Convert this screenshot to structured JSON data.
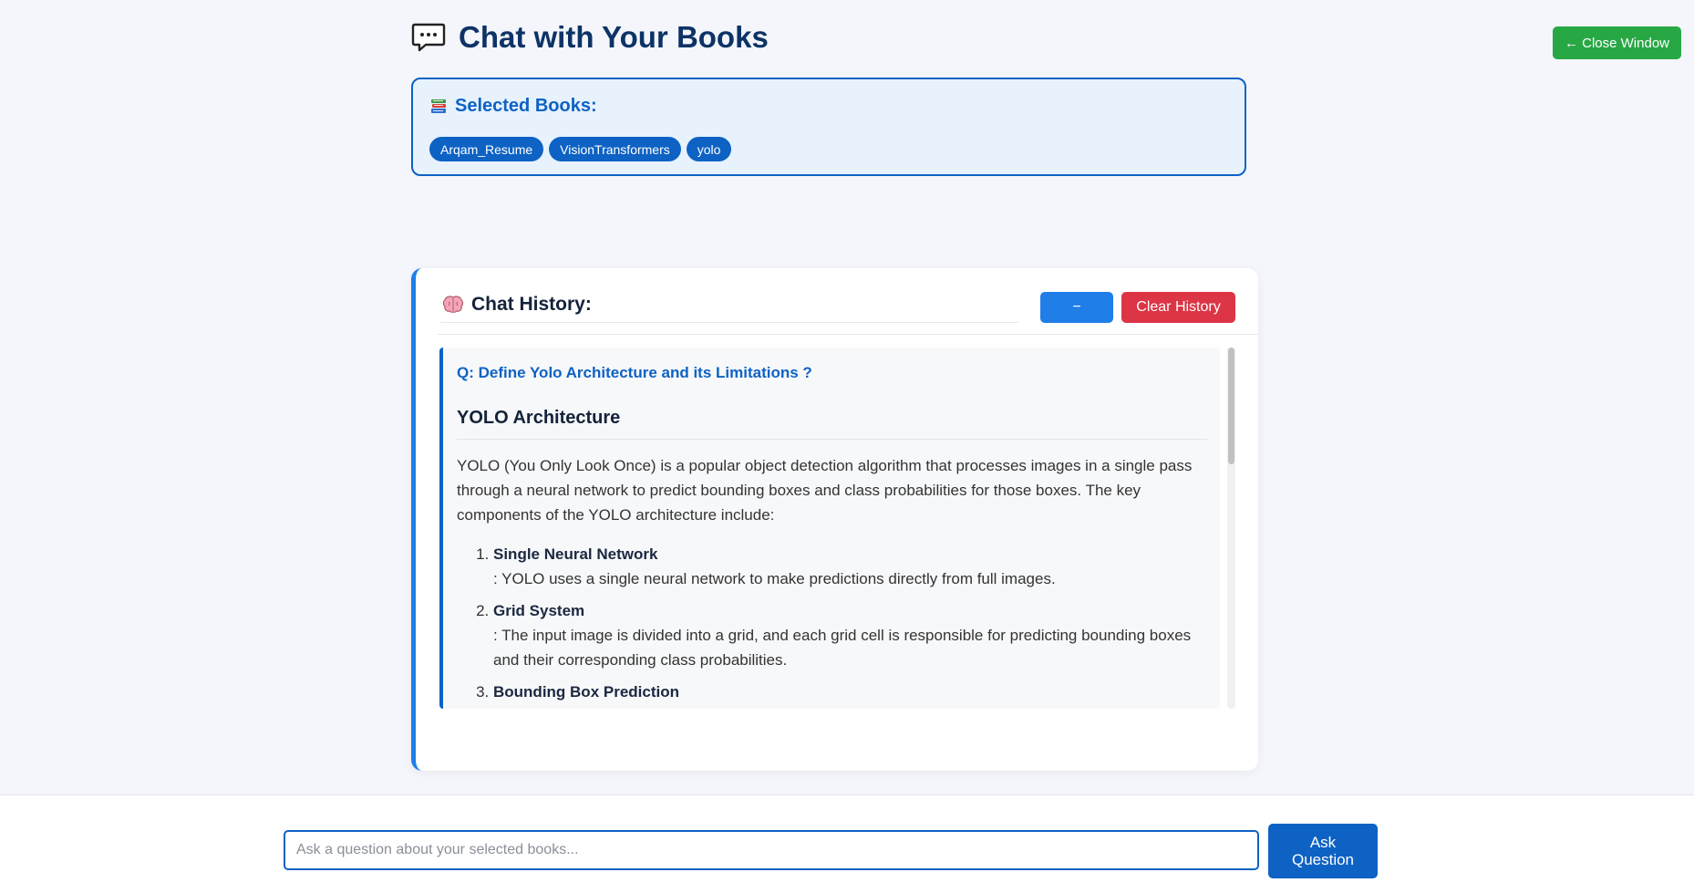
{
  "close_button": {
    "label": "← Close Window"
  },
  "header": {
    "title": "Chat with Your Books",
    "icon": "speech-bubble-icon"
  },
  "selected_books": {
    "heading": "Selected Books:",
    "icon": "books-icon",
    "tags": [
      "Arqam_Resume",
      "VisionTransformers",
      "yolo"
    ]
  },
  "history": {
    "title": "Chat History:",
    "icon": "brain-icon",
    "collapse_label": "−",
    "clear_label": "Clear History",
    "entry": {
      "question": "Q: Define Yolo Architecture and its Limitations ?",
      "heading": "YOLO Architecture",
      "intro": "YOLO (You Only Look Once) is a popular object detection algorithm that processes images in a single pass through a neural network to predict bounding boxes and class probabilities for those boxes. The key components of the YOLO architecture include:",
      "steps": [
        {
          "title": "Single Neural Network",
          "desc": ": YOLO uses a single neural network to make predictions directly from full images."
        },
        {
          "title": "Grid System",
          "desc": ": The input image is divided into a grid, and each grid cell is responsible for predicting bounding boxes and their corresponding class probabilities."
        },
        {
          "title": "Bounding Box Prediction",
          "desc": ""
        }
      ]
    }
  },
  "ask": {
    "placeholder": "Ask a question about your selected books...",
    "button_label": "Ask Question"
  },
  "colors": {
    "primary": "#0d62c4",
    "accent_blue": "#1f7ee8",
    "success": "#28a745",
    "danger": "#dc3545",
    "background": "#f4f6fb"
  }
}
